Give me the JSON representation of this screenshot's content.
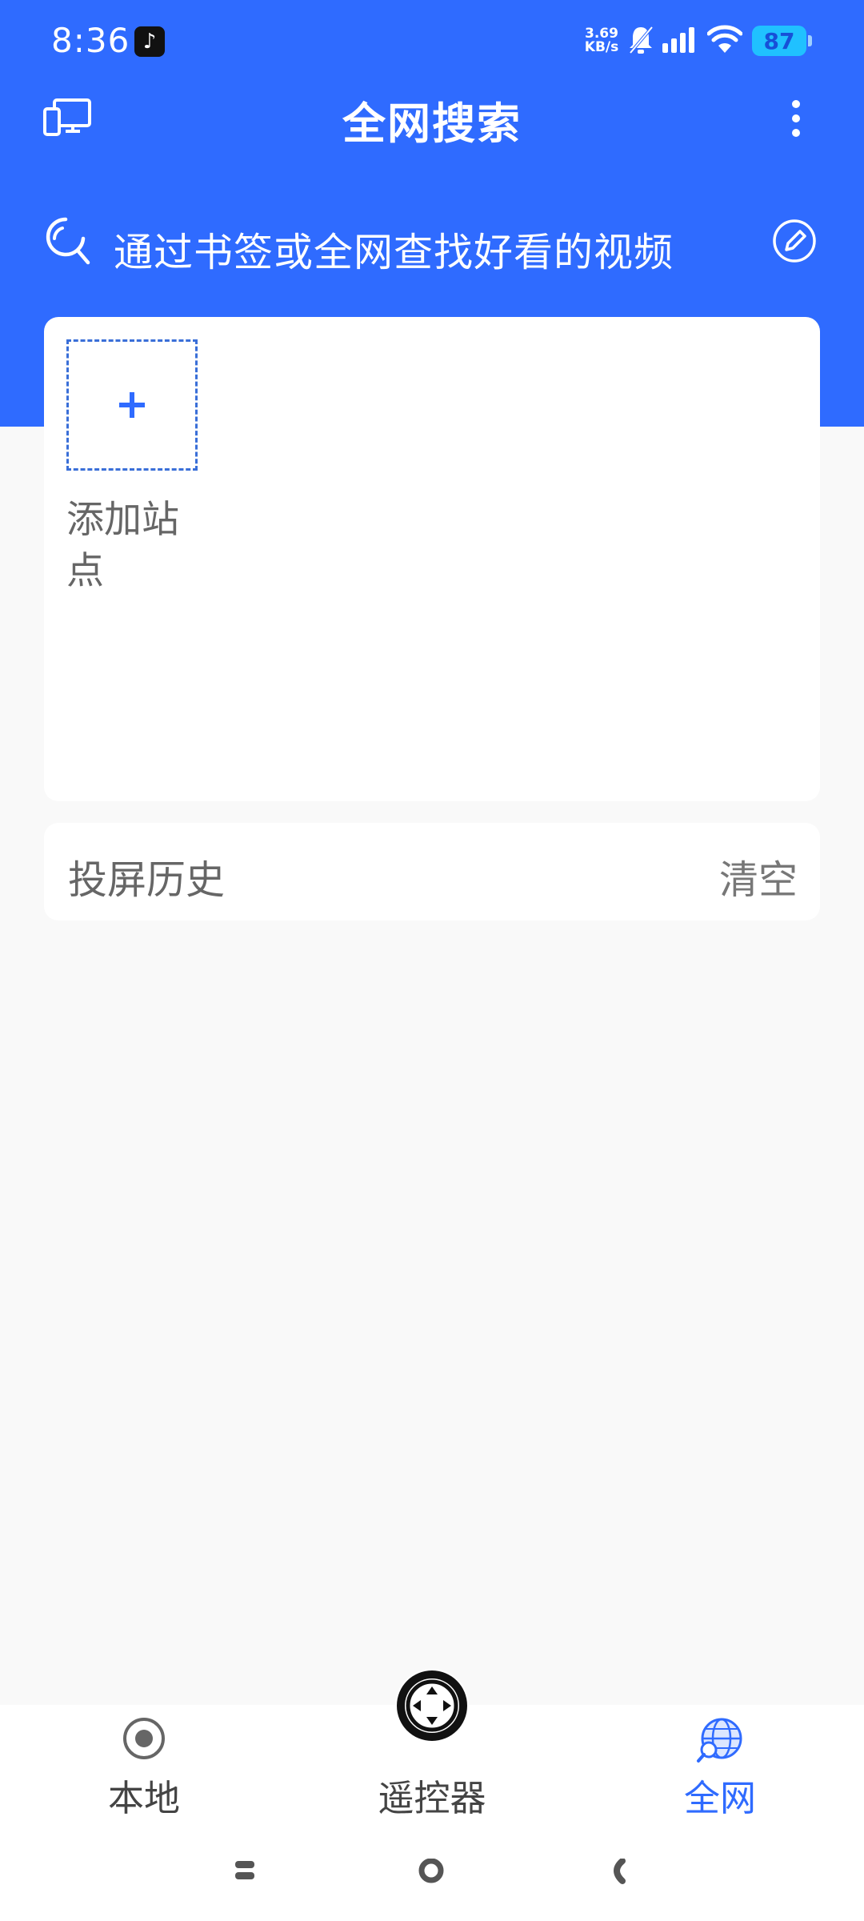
{
  "status_bar": {
    "time": "8:36",
    "app_badge_icon": "tiktok-icon",
    "net_speed_value": "3.69",
    "net_speed_unit": "KB/s",
    "battery": "87"
  },
  "app_bar": {
    "title": "全网搜索",
    "left_icon": "cast-devices-icon",
    "right_icon": "more-vertical-icon"
  },
  "search": {
    "placeholder": "通过书签或全网查找好看的视频",
    "right_icon": "edit-icon"
  },
  "sites": {
    "add_label": "添加站点"
  },
  "history": {
    "title": "投屏历史",
    "clear_label": "清空"
  },
  "bottom_nav": {
    "items": [
      {
        "label": "本地",
        "icon": "radio-dot-icon"
      },
      {
        "label": "遥控器",
        "icon": "remote-dpad-icon"
      },
      {
        "label": "全网",
        "icon": "globe-icon"
      }
    ],
    "active": "全网"
  },
  "colors": {
    "primary": "#2f6bff",
    "background": "#f9f9f9",
    "battery": "#20c1ff"
  }
}
